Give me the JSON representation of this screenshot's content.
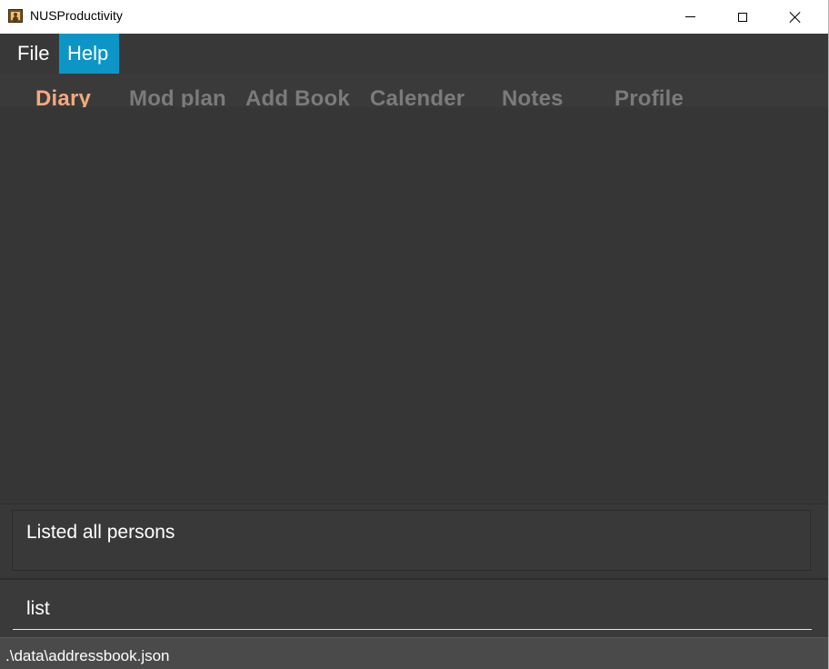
{
  "window": {
    "title": "NUSProductivity",
    "app_icon": "address-book-icon"
  },
  "menu": {
    "items": [
      {
        "label": "File",
        "active": false
      },
      {
        "label": "Help",
        "active": true
      }
    ]
  },
  "tabs": [
    {
      "label": "Diary",
      "active": true
    },
    {
      "label": "Mod plan",
      "active": false
    },
    {
      "label": "Add Book",
      "active": false
    },
    {
      "label": "Calender",
      "active": false
    },
    {
      "label": "Notes",
      "active": false
    },
    {
      "label": "Profile",
      "active": false
    }
  ],
  "result": {
    "text": "Listed all persons"
  },
  "command": {
    "value": "list"
  },
  "status": {
    "path": ".\\data\\addressbook.json"
  },
  "colors": {
    "accent": "#0c96c8",
    "active_tab": "#f5a97f",
    "inactive_tab": "#7b7b7b",
    "background": "#363636"
  }
}
